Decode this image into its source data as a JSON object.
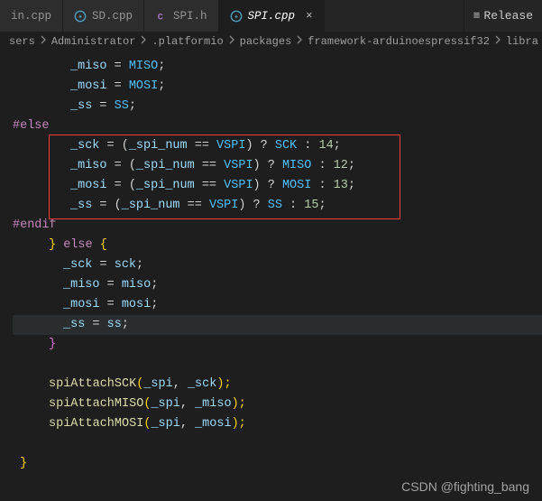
{
  "tabs": {
    "t0": {
      "label": "in.cpp"
    },
    "t1": {
      "label": "SD.cpp"
    },
    "t2": {
      "label": "SPI.h"
    },
    "t3": {
      "label": "SPI.cpp"
    },
    "release": "Release"
  },
  "breadcrumb": {
    "b0": "sers",
    "b1": "Administrator",
    "b2": ".platformio",
    "b3": "packages",
    "b4": "framework-arduinoespressif32",
    "b5": "libra"
  },
  "code": {
    "l01a": "_miso",
    "l01b": " = ",
    "l01c": "MISO",
    "l01d": ";",
    "l02a": "_mosi",
    "l02b": " = ",
    "l02c": "MOSI",
    "l02d": ";",
    "l03a": "_ss",
    "l03b": " = ",
    "l03c": "SS",
    "l03d": ";",
    "l04": "#else",
    "l05a": "_sck",
    "l05eq": " = (",
    "l05b": "_spi_num",
    "l05op": " == ",
    "l05c": "VSPI",
    "l05q": ") ? ",
    "l05d": "SCK",
    "l05col": " : ",
    "l05n": "14",
    "l05s": ";",
    "l06a": "_miso",
    "l06b": "_spi_num",
    "l06c": "VSPI",
    "l06d": "MISO",
    "l06n": "12",
    "l07a": "_mosi",
    "l07b": "_spi_num",
    "l07c": "VSPI",
    "l07d": "MOSI",
    "l07n": "13",
    "l08a": "_ss",
    "l08b": "_spi_num",
    "l08c": "VSPI",
    "l08d": "SS",
    "l08n": "15",
    "l09": "#endif",
    "l10a": "} ",
    "l10b": "else",
    "l10c": " {",
    "l11a": "_sck",
    "l11b": " = ",
    "l11c": "sck",
    "l11d": ";",
    "l12a": "_miso",
    "l12b": " = ",
    "l12c": "miso",
    "l12d": ";",
    "l13a": "_mosi",
    "l13b": " = ",
    "l13c": "mosi",
    "l13d": ";",
    "l14a": "_ss",
    "l14b": " = ",
    "l14c": "ss",
    "l14d": ";",
    "l15": "}",
    "l17a": "spiAttachSCK",
    "l17b": "(",
    "l17c": "_spi",
    "l17d": ", ",
    "l17e": "_sck",
    "l17f": ");",
    "l18a": "spiAttachMISO",
    "l18c": "_spi",
    "l18e": "_miso",
    "l19a": "spiAttachMOSI",
    "l19c": "_spi",
    "l19e": "_mosi",
    "l21": "}"
  },
  "watermark": "CSDN @fighting_bang"
}
